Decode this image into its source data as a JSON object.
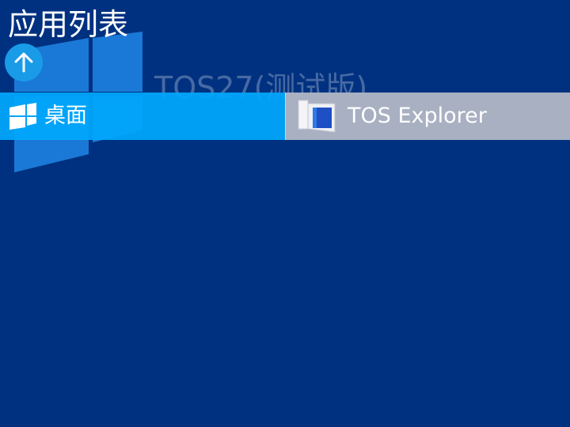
{
  "header": {
    "title": "应用列表",
    "back_icon": "arrow-up-icon"
  },
  "watermark": {
    "text": "TOS27(测试版)"
  },
  "apps": [
    {
      "label": "桌面",
      "icon": "windows-logo-icon",
      "color": "#00a8fc"
    },
    {
      "label": "TOS Explorer",
      "icon": "explorer-window-icon",
      "color": "#a8b0c2"
    }
  ],
  "colors": {
    "background": "#003180",
    "accent": "#1a9be8"
  }
}
